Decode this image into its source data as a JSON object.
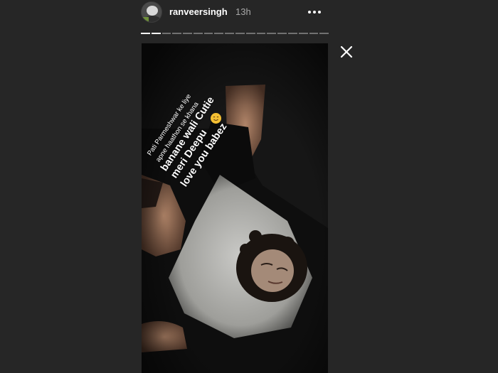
{
  "header": {
    "username": "ranveersingh",
    "time_ago": "13h",
    "avatar_icon": "profile-avatar",
    "more_icon": "more-dots-icon"
  },
  "progress": {
    "total_segments": 18,
    "completed_segments": 2
  },
  "close_icon": "close-icon",
  "story": {
    "caption_lines": [
      "Pati Parmeshwar ke liye",
      "apne haathon se khana",
      "banane wali Cutie",
      "meri Deepu",
      "love you babez"
    ],
    "emoji": "smiling-face-emoji"
  },
  "colors": {
    "background": "#262626",
    "text": "#ffffff",
    "muted_text": "#a8a8a8"
  }
}
